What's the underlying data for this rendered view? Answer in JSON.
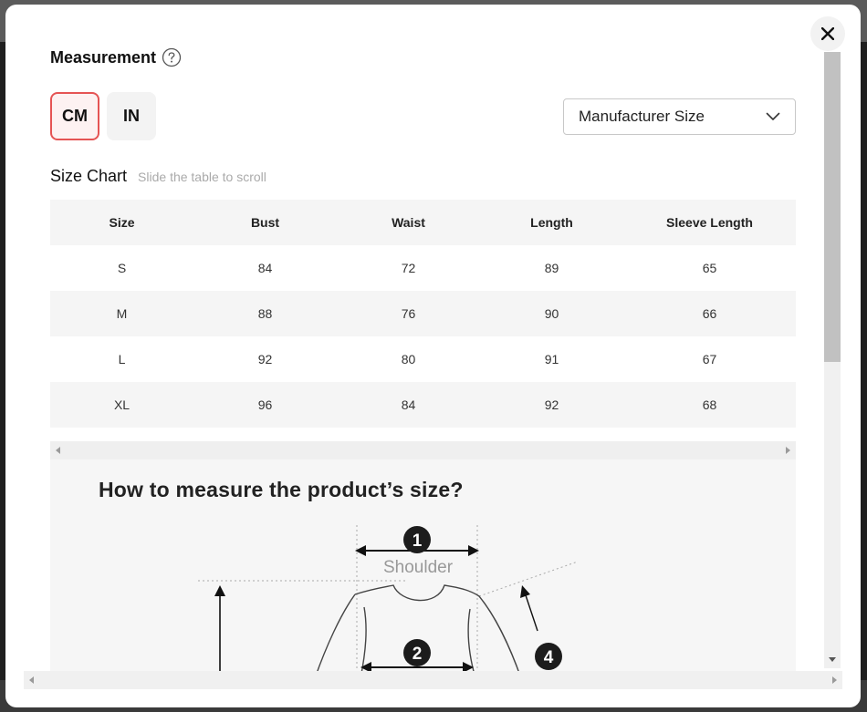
{
  "modal": {
    "title": "Measurement",
    "close_icon": "close-icon",
    "help_icon": "question-circle-icon"
  },
  "units": {
    "selected": "CM",
    "options": [
      {
        "label": "CM",
        "active": true
      },
      {
        "label": "IN",
        "active": false
      }
    ]
  },
  "size_select": {
    "value": "Manufacturer Size",
    "icon": "chevron-down-icon"
  },
  "size_chart": {
    "title": "Size Chart",
    "hint": "Slide the table to scroll",
    "columns": [
      "Size",
      "Bust",
      "Waist",
      "Length",
      "Sleeve Length"
    ],
    "rows": [
      [
        "S",
        "84",
        "72",
        "89",
        "65"
      ],
      [
        "M",
        "88",
        "76",
        "90",
        "66"
      ],
      [
        "L",
        "92",
        "80",
        "91",
        "67"
      ],
      [
        "XL",
        "96",
        "84",
        "92",
        "68"
      ]
    ]
  },
  "guide": {
    "title": "How to measure the product’s size?",
    "labels": {
      "m1": "1",
      "m2": "2",
      "m4": "4",
      "shoulder": "Shoulder"
    }
  },
  "colors": {
    "accent": "#e55454",
    "header_bg": "#f5f5f5",
    "marker": "#1c1c1c"
  }
}
